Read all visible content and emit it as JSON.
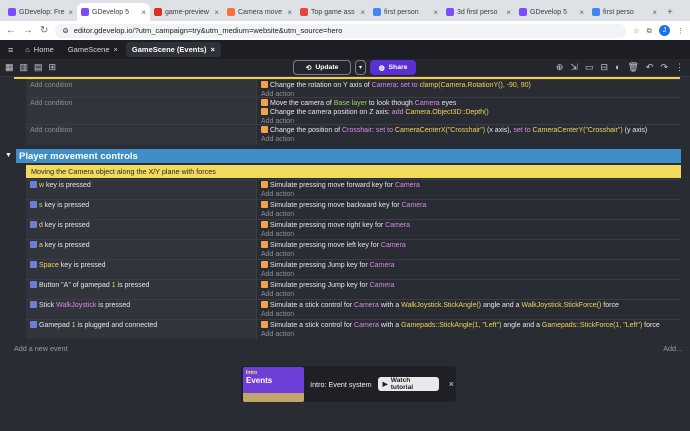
{
  "browser": {
    "tabs": [
      {
        "label": "GDevelop: Fre",
        "color": "#7c4dff"
      },
      {
        "label": "GDevelop 5",
        "color": "#7c4dff"
      },
      {
        "label": "game-preview",
        "color": "#d93025"
      },
      {
        "label": "Camera move",
        "color": "#ff6d3a"
      },
      {
        "label": "Top game ass",
        "color": "#e8453c"
      },
      {
        "label": "first person",
        "color": "#4285f4"
      },
      {
        "label": "3d first perso",
        "color": "#7c4dff"
      },
      {
        "label": "GDevelop 5",
        "color": "#7c4dff"
      },
      {
        "label": "first perso",
        "color": "#4285f4"
      }
    ],
    "url": "editor.gdevelop.io/?utm_campaign=try&utm_medium=website&utm_source=hero",
    "avatar": "J"
  },
  "app_tabs": {
    "home": "Home",
    "scene": "GameScene",
    "events": "GameScene (Events)"
  },
  "toolbar": {
    "update": "Update",
    "share": "Share"
  },
  "events": {
    "add_condition": "Add condition",
    "add_action": "Add action",
    "top": [
      {
        "lines": [
          [
            {
              "t": "Change the rotation on Y axis of "
            },
            {
              "t": "Camera",
              "c": "kw"
            },
            {
              "t": ": "
            },
            {
              "t": "set to",
              "c": "kw"
            },
            {
              "t": " clamp(Camera.RotationY(), -90, 90)",
              "c": "ex"
            }
          ]
        ]
      },
      {
        "lines": [
          [
            {
              "t": "Move the camera of "
            },
            {
              "t": "Base layer",
              "c": "lay"
            },
            {
              "t": " to look though "
            },
            {
              "t": "Camera",
              "c": "kw"
            },
            {
              "t": " eyes"
            }
          ],
          [
            {
              "t": "Change the camera position on Z axis: "
            },
            {
              "t": "add",
              "c": "kw"
            },
            {
              "t": " Camera.Object3D::Depth()",
              "c": "ex"
            }
          ]
        ]
      },
      {
        "lines": [
          [
            {
              "t": "Change the position of "
            },
            {
              "t": "Crosshair",
              "c": "kw"
            },
            {
              "t": ": "
            },
            {
              "t": "set to",
              "c": "kw"
            },
            {
              "t": " CameraCenterX(\"Crosshair\")",
              "c": "ex"
            },
            {
              "t": " (x axis), "
            },
            {
              "t": "set to",
              "c": "kw"
            },
            {
              "t": " CameraCenterY(\"Crosshair\")",
              "c": "ex"
            },
            {
              "t": " (y axis)"
            }
          ]
        ]
      }
    ],
    "group": "Player movement controls",
    "comment": "Moving the Camera object along the X/Y plane with forces",
    "rows": [
      {
        "cond": [
          {
            "t": "w",
            "c": "ex"
          },
          {
            "t": " key is pressed"
          }
        ],
        "act": [
          {
            "t": "Simulate pressing move forward key for "
          },
          {
            "t": "Camera",
            "c": "kw"
          }
        ]
      },
      {
        "cond": [
          {
            "t": "s",
            "c": "ex"
          },
          {
            "t": " key is pressed"
          }
        ],
        "act": [
          {
            "t": "Simulate pressing move backward key for "
          },
          {
            "t": "Camera",
            "c": "kw"
          }
        ]
      },
      {
        "cond": [
          {
            "t": "d",
            "c": "ex"
          },
          {
            "t": " key is pressed"
          }
        ],
        "act": [
          {
            "t": "Simulate pressing move right key for "
          },
          {
            "t": "Camera",
            "c": "kw"
          }
        ]
      },
      {
        "cond": [
          {
            "t": "a",
            "c": "ex"
          },
          {
            "t": " key is pressed"
          }
        ],
        "act": [
          {
            "t": "Simulate pressing move left key for "
          },
          {
            "t": "Camera",
            "c": "kw"
          }
        ]
      },
      {
        "cond": [
          {
            "t": "Space",
            "c": "ex"
          },
          {
            "t": " key is pressed"
          }
        ],
        "act": [
          {
            "t": "Simulate pressing Jump key for "
          },
          {
            "t": "Camera",
            "c": "kw"
          }
        ]
      },
      {
        "cond": [
          {
            "t": "Button \"A\" of gamepad "
          },
          {
            "t": "1",
            "c": "ex"
          },
          {
            "t": " is pressed"
          }
        ],
        "act": [
          {
            "t": "Simulate pressing Jump key for "
          },
          {
            "t": "Camera",
            "c": "kw"
          }
        ]
      },
      {
        "cond": [
          {
            "t": "Stick "
          },
          {
            "t": "WalkJoystick",
            "c": "kw"
          },
          {
            "t": " is pressed"
          }
        ],
        "act": [
          {
            "t": "Simulate a stick control for "
          },
          {
            "t": "Camera",
            "c": "kw"
          },
          {
            "t": " with a "
          },
          {
            "t": "WalkJoystick.StickAngle()",
            "c": "ex"
          },
          {
            "t": " angle and a "
          },
          {
            "t": "WalkJoystick.StickForce()",
            "c": "ex"
          },
          {
            "t": " force"
          }
        ]
      },
      {
        "cond": [
          {
            "t": "Gamepad "
          },
          {
            "t": "1",
            "c": "ex"
          },
          {
            "t": " is plugged and connected"
          }
        ],
        "act": [
          {
            "t": "Simulate a stick control for "
          },
          {
            "t": "Camera",
            "c": "kw"
          },
          {
            "t": " with a "
          },
          {
            "t": "Gamepads::StickAngle(1, \"Left\")",
            "c": "ex"
          },
          {
            "t": " angle and a "
          },
          {
            "t": "Gamepads::StickForce(1, \"Left\")",
            "c": "ex"
          },
          {
            "t": " force"
          }
        ]
      }
    ],
    "add_event": "Add a new event",
    "add_more": "Add..."
  },
  "tutorial": {
    "tag": "Intro",
    "thumb_title": "Events",
    "label": "Intro: Event system",
    "button": "Watch tutorial"
  }
}
